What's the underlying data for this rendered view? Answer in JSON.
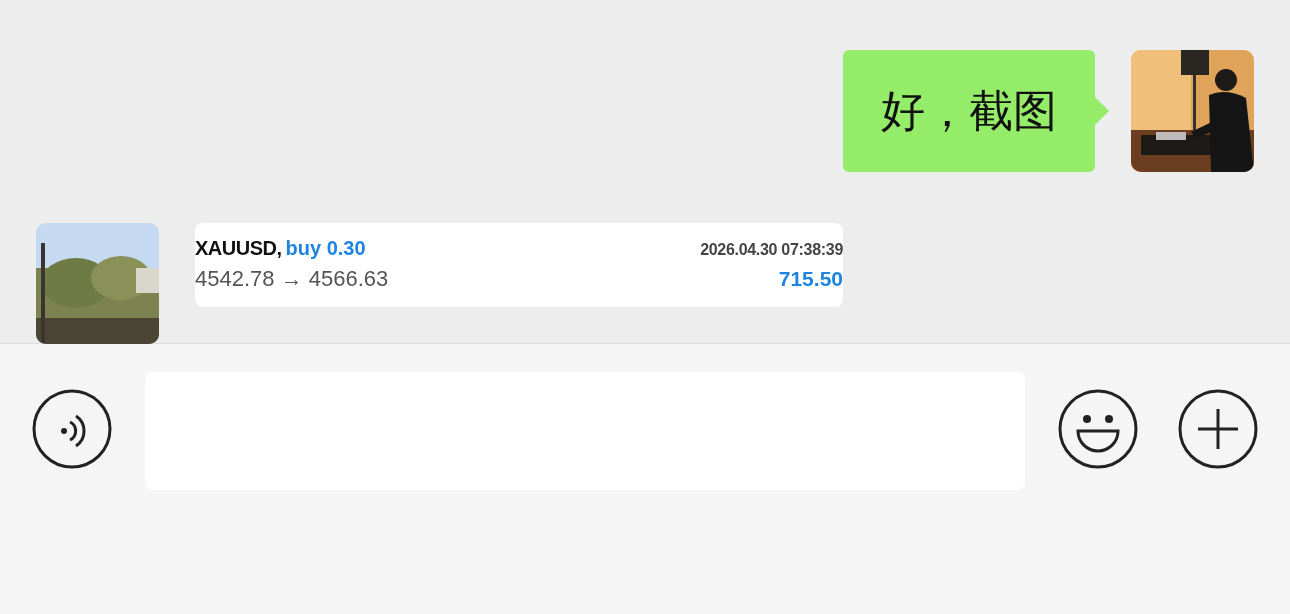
{
  "messages": [
    {
      "kind": "text",
      "text": "好，截图"
    },
    {
      "kind": "trade",
      "symbol": "XAUUSD,",
      "order": "buy 0.30",
      "time": "2026.04.30 07:38:39",
      "prices": "4542.78 → 4566.63",
      "profit": "715.50"
    }
  ]
}
